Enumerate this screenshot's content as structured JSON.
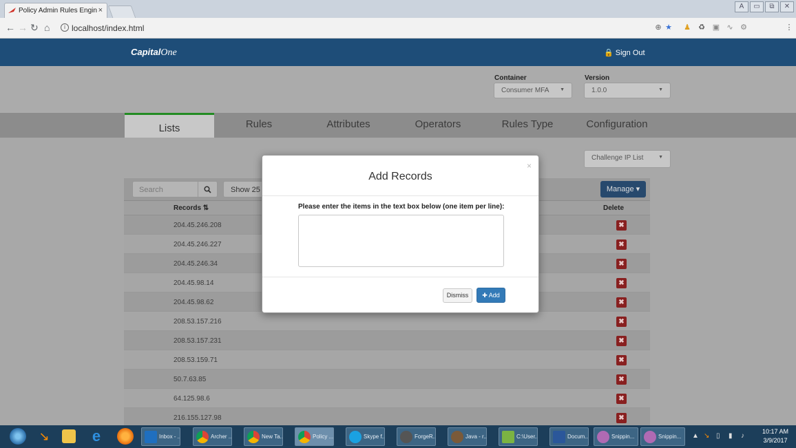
{
  "browser": {
    "tab_title": "Policy Admin Rules Engin",
    "tab_close": "×",
    "url": "localhost/index.html",
    "window_controls": [
      "A",
      "▭",
      "⧉",
      "✕"
    ]
  },
  "header": {
    "logo_main": "Capital",
    "logo_one": "One",
    "sign_out": "🔒 Sign Out"
  },
  "selectors": {
    "container_label": "Container",
    "container_value": "Consumer MFA",
    "version_label": "Version",
    "version_value": "1.0.0"
  },
  "tabs": [
    {
      "label": "Lists"
    },
    {
      "label": "Rules"
    },
    {
      "label": "Attributes"
    },
    {
      "label": "Operators"
    },
    {
      "label": "Rules Type"
    },
    {
      "label": "Configuration"
    }
  ],
  "list_select": "Challenge IP List",
  "table": {
    "search_placeholder": "Search",
    "show_label": "Show 25 per page",
    "manage_label": "Manage ▾",
    "col_records": "Records ⇅",
    "col_delete": "Delete",
    "rows": [
      "204.45.246.208",
      "204.45.246.227",
      "204.45.246.34",
      "204.45.98.14",
      "204.45.98.62",
      "208.53.157.216",
      "208.53.157.231",
      "208.53.159.71",
      "50.7.63.85",
      "64.125.98.6",
      "216.155.127.98"
    ]
  },
  "modal": {
    "title": "Add Records",
    "close": "×",
    "instructions": "Please enter the items in the text box below (one item per line):",
    "textarea_value": "",
    "dismiss": "Dismiss",
    "add": "✚ Add"
  },
  "taskbar": {
    "buttons": [
      "Inbox - ...",
      "Archer ...",
      "New Ta...",
      "Policy ...",
      "Skype f...",
      "ForgeR...",
      "Java - r...",
      "C:\\User...",
      "Docum...",
      "Snippin...",
      "Snippin..."
    ],
    "time": "10:17 AM",
    "date": "3/9/2017"
  }
}
